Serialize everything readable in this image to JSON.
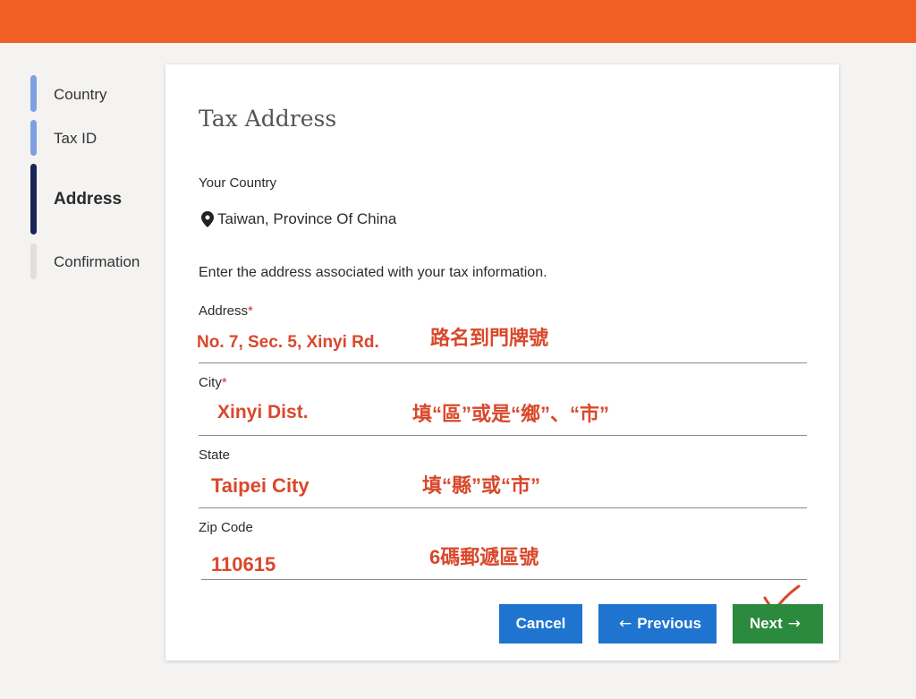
{
  "stepper": {
    "steps": [
      {
        "label": "Country"
      },
      {
        "label": "Tax ID"
      },
      {
        "label": "Address"
      },
      {
        "label": "Confirmation"
      }
    ]
  },
  "form": {
    "title": "Tax Address",
    "country_label": "Your Country",
    "country_value": "Taiwan, Province Of China",
    "intro": "Enter the address associated with your tax information.",
    "fields": [
      {
        "label": "Address",
        "required": "*",
        "value": "No. 7, Sec. 5, Xinyi Rd.",
        "note": "路名到門牌號"
      },
      {
        "label": "City",
        "required": "*",
        "value": "Xinyi Dist.",
        "note": "填“區”或是“鄉”、“市”"
      },
      {
        "label": "State",
        "required": "",
        "value": "Taipei City",
        "note": "填“縣”或“市”"
      },
      {
        "label": "Zip Code",
        "required": "",
        "value": "110615",
        "note": "6碼郵遞區號"
      }
    ]
  },
  "buttons": {
    "cancel": "Cancel",
    "previous": "Previous",
    "next": "Next"
  },
  "colors": {
    "topbar": "#f25f24",
    "primary_button": "#1f74cf",
    "next_button": "#2b8a3e",
    "annotation": "#d9482b",
    "active_step": "#1b2456",
    "completed_step": "#7ea0e3"
  },
  "icons": [
    "location-pin-icon",
    "arrow-left-icon",
    "arrow-right-icon",
    "checkmark-annotation-icon"
  ]
}
